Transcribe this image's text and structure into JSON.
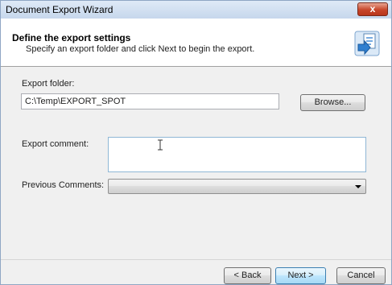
{
  "window": {
    "title": "Document Export Wizard",
    "close_label": "x"
  },
  "header": {
    "title": "Define the export settings",
    "subtitle": "Specify an export folder and click Next to begin the export.",
    "icon": "export-document-icon"
  },
  "form": {
    "export_folder_label": "Export folder:",
    "export_folder_value": "C:\\Temp\\EXPORT_SPOT",
    "browse_label": "Browse...",
    "export_comment_label": "Export comment:",
    "export_comment_value": "",
    "previous_comments_label": "Previous Comments:",
    "previous_comments_value": ""
  },
  "footer": {
    "back_label": "< Back",
    "next_label": "Next >",
    "cancel_label": "Cancel"
  },
  "colors": {
    "title_bar": "#c6d7ec",
    "close_button": "#c7462a",
    "default_button_border": "#3c7fb1"
  }
}
